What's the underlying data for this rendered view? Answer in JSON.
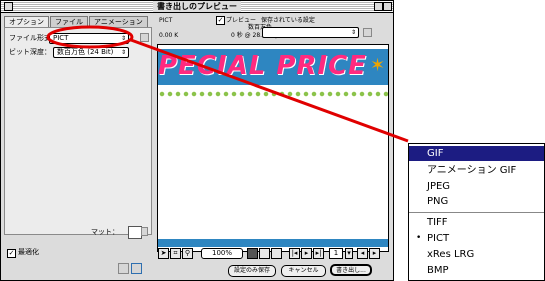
{
  "window": {
    "title": "書き出しのプレビュー",
    "tabs": [
      "オプション",
      "ファイル",
      "アニメーション"
    ]
  },
  "options": {
    "file_format_label": "ファイル形式：",
    "file_format_value": "PICT",
    "bit_depth_label": "ビット深度：",
    "bit_depth_value": "数百万色 (24 Bit)",
    "matte_label": "マット：",
    "optimize_label": "最適化"
  },
  "preview": {
    "format": "PICT",
    "size": "0.00 K",
    "preview_checkbox_label": "プレビュー",
    "saved_settings_label": "保存されている設定",
    "colors_label": "数百万色",
    "time_text": "0 秒 @ 28.8 kbps",
    "banner_text": "PECIAL PRICE",
    "zoom_value": "100%",
    "frame_value": "1"
  },
  "buttons": {
    "save_settings": "設定のみ保存",
    "cancel": "キャンセル",
    "export": "書き出し..."
  },
  "format_menu": {
    "items": [
      "GIF",
      "アニメーション GIF",
      "JPEG",
      "PNG",
      "TIFF",
      "PICT",
      "xRes LRG",
      "BMP"
    ],
    "selected": "PICT",
    "highlighted": "GIF"
  },
  "colors": {
    "highlight": "#1c1c82",
    "callout_red": "#e00000",
    "banner_blue": "#2e86c1",
    "banner_pink": "#ff2a7f"
  }
}
